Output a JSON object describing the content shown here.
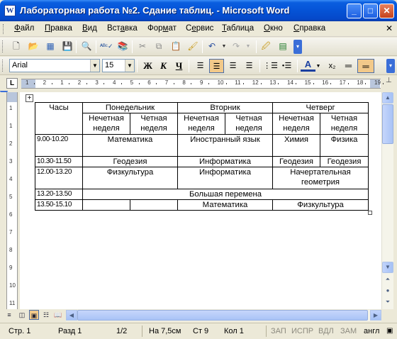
{
  "window": {
    "title": "Лабораторная работа №2. Сдание таблиц. - Microsoft Word",
    "app_icon": "W",
    "minimize_glyph": "_",
    "maximize_glyph": "□",
    "close_glyph": "✕"
  },
  "menu": {
    "items": [
      {
        "u": "Ф",
        "rest": "айл"
      },
      {
        "u": "П",
        "rest": "равка"
      },
      {
        "u": "В",
        "rest": "ид"
      },
      {
        "u": "",
        "pre": "Вст",
        "u2": "а",
        "rest": "вка"
      },
      {
        "u": "",
        "pre": "Фор",
        "u2": "м",
        "rest": "ат"
      },
      {
        "u": "",
        "pre": "С",
        "u2": "е",
        "rest": "рвис"
      },
      {
        "u": "Т",
        "rest": "аблица"
      },
      {
        "u": "О",
        "rest": "кно"
      },
      {
        "u": "С",
        "rest": "правка"
      }
    ],
    "close_doc": "✕"
  },
  "formatting": {
    "font": "Arial",
    "size": "15",
    "bold": "Ж",
    "italic": "К",
    "underline": "Ч"
  },
  "ruler": {
    "corner": "L",
    "h_numbers": [
      "1",
      "2",
      "1",
      "2",
      "3",
      "4",
      "5",
      "6",
      "7",
      "8",
      "9",
      "10",
      "11",
      "12",
      "13",
      "14",
      "15",
      "16",
      "17",
      "18",
      "19"
    ],
    "v_numbers": [
      "1",
      "1",
      "2",
      "3",
      "4",
      "5",
      "6",
      "7",
      "8",
      "9",
      "10",
      "11"
    ]
  },
  "table": {
    "header": {
      "hours": "Часы",
      "days": [
        "Понедельник",
        "Вторник",
        "Четверг"
      ],
      "odd": "Нечетная неделя",
      "even": "Четная неделя"
    },
    "rows": [
      {
        "time": "9.00-10.20",
        "mon": "Математика",
        "tue": "Иностранный язык",
        "thu_odd": "Химия",
        "thu_even": "Физика"
      },
      {
        "time": "10.30-11.50",
        "mon": "Геодезия",
        "tue": "Информатика",
        "thu_odd": "Геодезия",
        "thu_even": "Геодезия"
      },
      {
        "time": "12.00-13.20",
        "mon": "Физкультура",
        "tue": "Информатика",
        "thu": "Начертательная геометрия"
      },
      {
        "time": "13.20-13.50",
        "merged": "Большая перемена"
      },
      {
        "time": "13.50-15.10",
        "mon_odd": "",
        "mon_even": "",
        "tue": "Математика",
        "thu": "Физкультура"
      }
    ]
  },
  "status": {
    "page": "Стр. 1",
    "section": "Разд 1",
    "pages": "1/2",
    "at": "На 7,5см",
    "line": "Ст 9",
    "col": "Кол 1",
    "rec": "ЗАП",
    "trk": "ИСПР",
    "ext": "ВДЛ",
    "ovr": "ЗАМ",
    "lang": "англ"
  }
}
